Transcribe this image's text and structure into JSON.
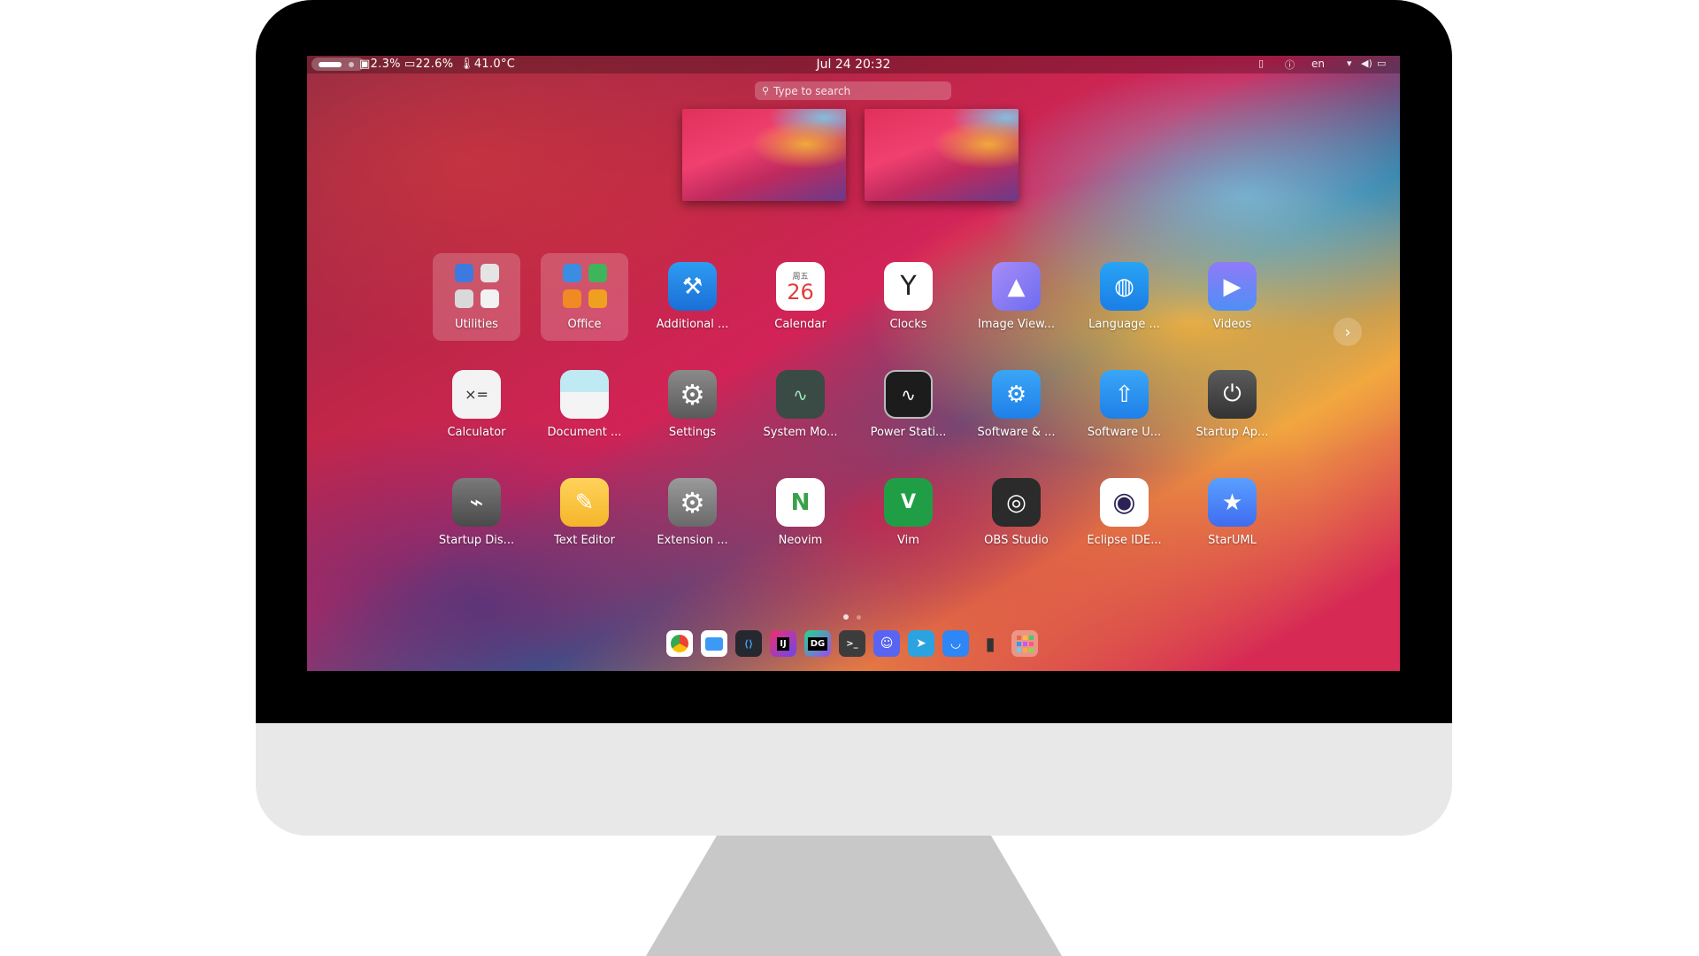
{
  "topbar": {
    "stat_cpu": "2.3%",
    "stat_mem": "22.6%",
    "stat_temp": "41.0°C",
    "clock": "Jul 24  20:32",
    "lang": "en"
  },
  "search": {
    "placeholder": "Type to search"
  },
  "apps_page": {
    "row1": [
      {
        "label": "Utilities",
        "icon": "utilities-folder-icon"
      },
      {
        "label": "Office",
        "icon": "office-folder-icon"
      },
      {
        "label": "Additional ...",
        "icon": "hammer-wrench-icon"
      },
      {
        "label": "Calendar",
        "icon": "calendar-icon",
        "day": "26",
        "weekday": "周五"
      },
      {
        "label": "Clocks",
        "icon": "clock-icon"
      },
      {
        "label": "Image View...",
        "icon": "image-viewer-icon"
      },
      {
        "label": "Language ...",
        "icon": "globe-icon"
      },
      {
        "label": "Videos",
        "icon": "play-icon"
      }
    ],
    "row2": [
      {
        "label": "Calculator",
        "icon": "calculator-icon"
      },
      {
        "label": "Document ...",
        "icon": "document-scanner-icon"
      },
      {
        "label": "Settings",
        "icon": "gear-icon"
      },
      {
        "label": "System Mo...",
        "icon": "system-monitor-icon"
      },
      {
        "label": "Power Stati...",
        "icon": "power-statistics-icon"
      },
      {
        "label": "Software & ...",
        "icon": "software-sources-icon"
      },
      {
        "label": "Software U...",
        "icon": "software-updater-icon"
      },
      {
        "label": "Startup Ap...",
        "icon": "power-icon"
      }
    ],
    "row3": [
      {
        "label": "Startup Dis...",
        "icon": "usb-drive-icon"
      },
      {
        "label": "Text Editor",
        "icon": "pen-icon"
      },
      {
        "label": "Extension ...",
        "icon": "extension-gear-icon"
      },
      {
        "label": "Neovim",
        "icon": "neovim-icon"
      },
      {
        "label": "Vim",
        "icon": "vim-icon"
      },
      {
        "label": "OBS Studio",
        "icon": "obs-icon"
      },
      {
        "label": "Eclipse IDE...",
        "icon": "eclipse-icon"
      },
      {
        "label": "StarUML",
        "icon": "star-icon"
      }
    ]
  },
  "pager": {
    "current": 1,
    "total": 2
  },
  "dock": [
    "chrome-icon",
    "files-icon",
    "vscode-icon",
    "intellij-icon",
    "datagrip-icon",
    "terminal-icon",
    "discord-icon",
    "telegram-icon",
    "software-store-icon",
    "trash-icon",
    "app-grid-icon"
  ],
  "dock_labels": {
    "vscode": "⟨⟩",
    "intellij": "IJ",
    "datagrip": "DG",
    "terminal": ">_"
  },
  "colors": {
    "accent": "#2f86f5",
    "bezel": "#000000",
    "chin": "#e8e8e8",
    "stand": "#c8c8c8"
  }
}
